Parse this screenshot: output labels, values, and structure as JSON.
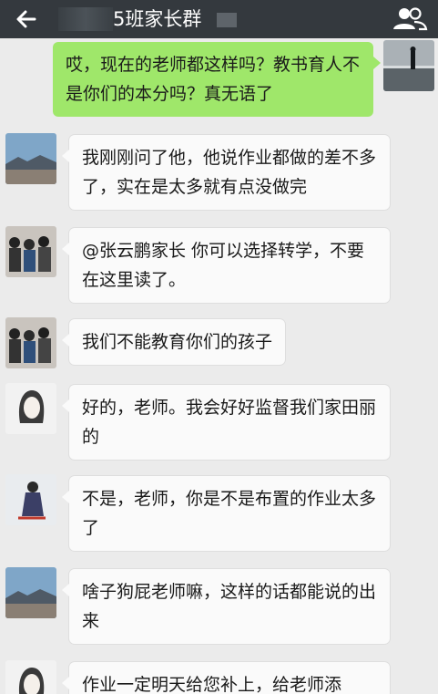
{
  "header": {
    "title": "5班家长群",
    "back_icon": "arrow-left-icon",
    "members_icon": "people-icon"
  },
  "messages": [
    {
      "from": "me",
      "text": "哎，现在的老师都这样吗？教书育人不是你们的本分吗？真无语了",
      "avatar": "lake-silhouette"
    },
    {
      "from": "other",
      "text": "我刚刚问了他，他说作业都做的差不多了，实在是太多就有点没做完",
      "avatar": "landscape"
    },
    {
      "from": "other",
      "text": "@张云鹏家长 你可以选择转学，不要在这里读了。",
      "avatar": "crowd"
    },
    {
      "from": "other",
      "text": "我们不能教育你们的孩子",
      "avatar": "crowd"
    },
    {
      "from": "other",
      "text": "好的，老师。我会好好监督我们家田丽的",
      "avatar": "girl-sketch"
    },
    {
      "from": "other",
      "text": "不是，老师，你是不是布置的作业太多了",
      "avatar": "figure"
    },
    {
      "from": "other",
      "text": "啥子狗屁老师嘛，这样的话都能说的出来",
      "avatar": "landscape"
    },
    {
      "from": "other",
      "text": "作业一定明天给您补上，给老师添",
      "avatar": "girl-sketch"
    }
  ]
}
